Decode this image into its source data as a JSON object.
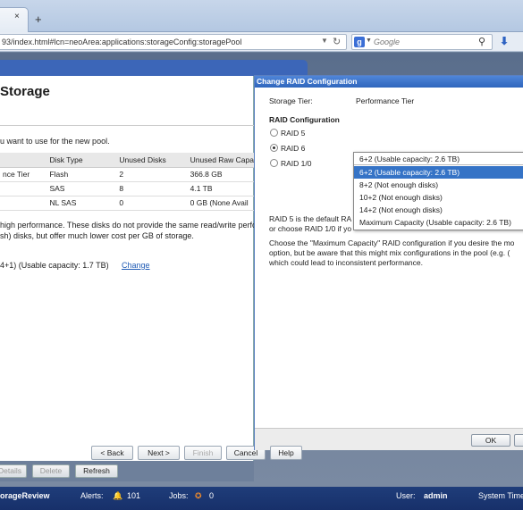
{
  "browser": {
    "url": "93/index.html#lcn=neoArea:applications:storageConfig:storagePool",
    "search_placeholder": "Google",
    "search_engine_letter": "g",
    "close_tab_symbol": "×",
    "new_tab_symbol": "+"
  },
  "wizard": {
    "title": "Storage",
    "intro": "u want to use for the new pool.",
    "table": {
      "headers": [
        "",
        "Disk Type",
        "Unused Disks",
        "Unused Raw Capa"
      ],
      "rows": [
        [
          "nce Tier",
          "Flash",
          "2",
          "366.8 GB"
        ],
        [
          "",
          "SAS",
          "8",
          "4.1 TB"
        ],
        [
          "",
          "NL SAS",
          "0",
          "0 GB (None Avail"
        ]
      ]
    },
    "note_line1": "high performance. These disks do not provide the same read/write perfo",
    "note_line2": "sh) disks, but offer much lower cost per GB of storage.",
    "current_config": "4+1) (Usable capacity: 1.7 TB)",
    "change_link": "Change",
    "buttons": {
      "back": "< Back",
      "next": "Next >",
      "finish": "Finish",
      "cancel": "Cancel",
      "help": "Help"
    }
  },
  "toolbar": {
    "details": "Details",
    "delete": "Delete",
    "refresh": "Refresh"
  },
  "statusbar": {
    "app_name": "orageReview",
    "alerts_label": "Alerts:",
    "alerts_count": "101",
    "jobs_label": "Jobs:",
    "jobs_count": "0",
    "user_label": "User:",
    "user_name": "admin",
    "system_time_label": "System Time"
  },
  "modal": {
    "title": "Change RAID Configuration",
    "storage_tier_label": "Storage Tier:",
    "storage_tier_value": "Performance Tier",
    "raid_config_heading": "RAID Configuration",
    "raid_options": [
      "RAID 5",
      "RAID 6",
      "RAID 1/0"
    ],
    "raid_selected": "RAID 6",
    "dropdown_options": [
      "6+2 (Usable capacity: 2.6 TB)",
      "6+2 (Usable capacity: 2.6 TB)",
      "8+2 (Not enough disks)",
      "10+2 (Not enough disks)",
      "14+2 (Not enough disks)",
      "Maximum Capacity (Usable capacity: 2.6 TB)"
    ],
    "dropdown_highlighted_index": 1,
    "desc_line1": "RAID 5 is the default RA",
    "desc_line2": "or choose RAID 1/0 if yo",
    "desc_line3": "Choose the \"Maximum Capacity\" RAID configuration if you desire the mo",
    "desc_line4": "option, but be aware that this might mix configurations in the pool (e.g. (",
    "desc_line5": "which could lead to inconsistent performance.",
    "ok_label": "OK"
  },
  "colors": {
    "modal_title_bg": "#2f66bd",
    "statusbar_bg": "#1f3d7a",
    "selection": "#3573c6",
    "link": "#1f5bb5"
  }
}
